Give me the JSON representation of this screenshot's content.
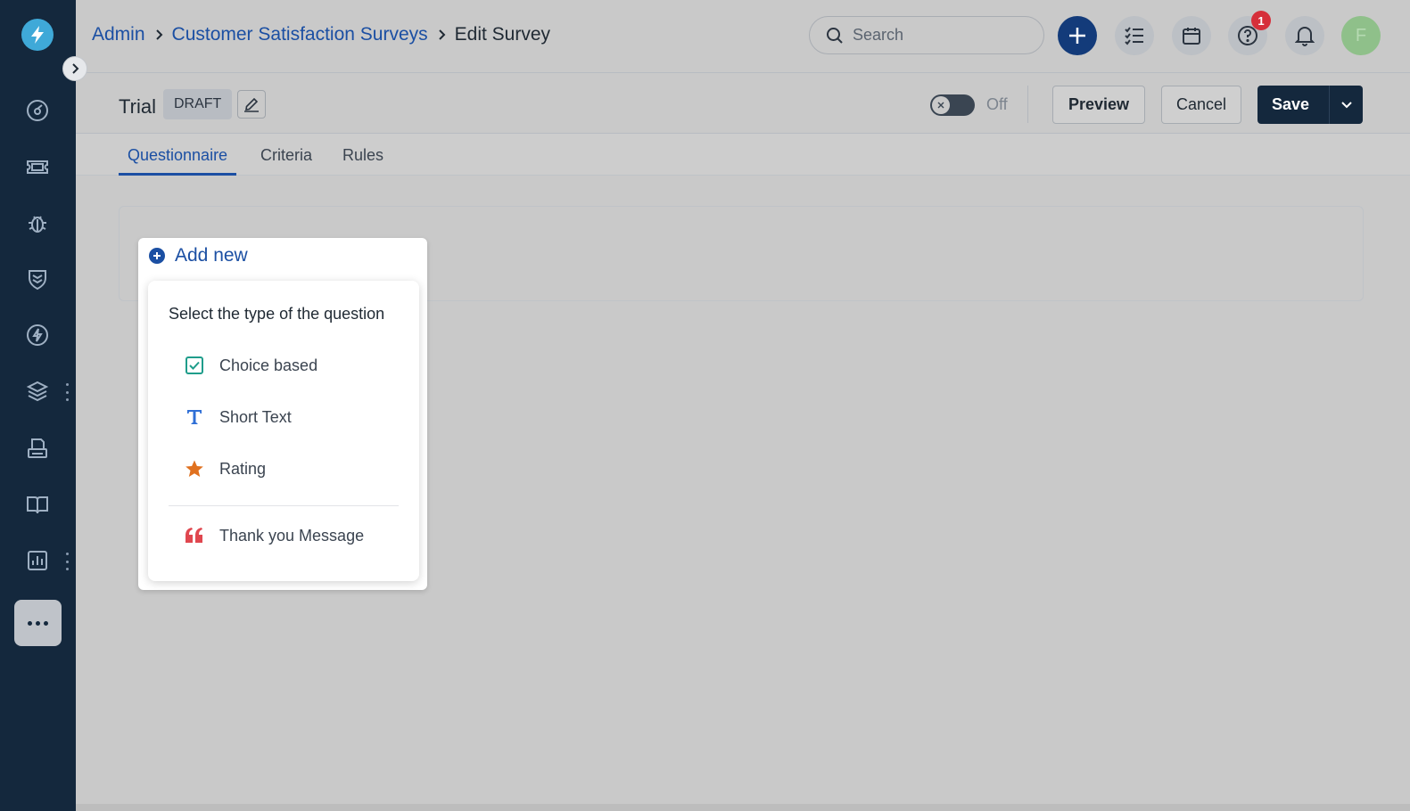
{
  "app": {
    "logo_icon": "bolt-logo-icon",
    "brand_color": "#3fa9d8",
    "sidebar_bg": "#14283d",
    "accent_color": "#1b4fa3"
  },
  "sidebar": {
    "items": [
      {
        "icon": "dashboard-icon"
      },
      {
        "icon": "ticket-icon"
      },
      {
        "icon": "bug-icon"
      },
      {
        "icon": "shield-icon"
      },
      {
        "icon": "bolt-circle-icon"
      },
      {
        "icon": "layers-icon"
      },
      {
        "icon": "printer-icon"
      },
      {
        "icon": "book-icon"
      },
      {
        "icon": "report-chart-icon"
      }
    ],
    "more_icon": "more-horizontal-icon"
  },
  "topbar": {
    "breadcrumb": [
      "Admin",
      "Customer Satisfaction Surveys",
      "Edit Survey"
    ],
    "search_placeholder": "Search",
    "help_badge_count": "1",
    "avatar_initial": "F"
  },
  "survey": {
    "name": "Trial",
    "status_badge": "DRAFT",
    "toggle_state": "Off",
    "preview_label": "Preview",
    "cancel_label": "Cancel",
    "save_label": "Save"
  },
  "tabs": [
    {
      "label": "Questionnaire",
      "active": true
    },
    {
      "label": "Criteria",
      "active": false
    },
    {
      "label": "Rules",
      "active": false
    }
  ],
  "add_new": {
    "label": "Add new",
    "menu_title": "Select the type of the question",
    "options": [
      {
        "label": "Choice based",
        "icon": "checkbox-icon",
        "color": "#1f9d8b"
      },
      {
        "label": "Short Text",
        "icon": "text-t-icon",
        "color": "#2f6fd6"
      },
      {
        "label": "Rating",
        "icon": "star-icon",
        "color": "#e0711f"
      },
      {
        "label": "Thank you Message",
        "icon": "quote-icon",
        "color": "#e0474f"
      }
    ]
  }
}
